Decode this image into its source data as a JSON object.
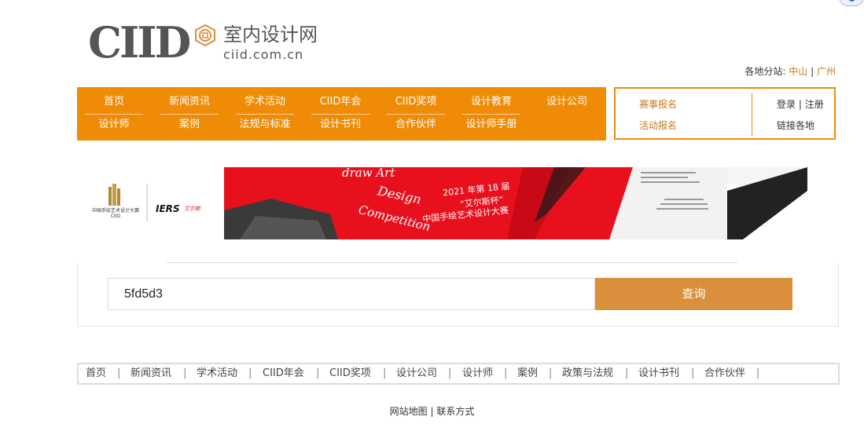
{
  "logo": {
    "mark": "CIID",
    "name_cn": "室内设计网",
    "domain": "ciid.com.cn"
  },
  "branches": {
    "label": "各地分站:",
    "items": [
      "中山",
      "广州"
    ],
    "separator": "|"
  },
  "nav": {
    "row1": [
      "首页",
      "新闻资讯",
      "学术活动",
      "CIID年会",
      "CIID奖项",
      "设计教育",
      "设计公司"
    ],
    "row2": [
      "设计师",
      "案例",
      "法规与标准",
      "设计书刊",
      "合作伙伴",
      "设计师手册"
    ]
  },
  "side": {
    "contest_signup": "赛事报名",
    "event_signup": "活动报名",
    "login": "登录",
    "register": "注册",
    "branch_links": "链接各地"
  },
  "banner": {
    "sponsor1": "中国手绘艺术设计大赛",
    "sponsor1_sub": "CIID",
    "sponsor2": "IERS",
    "sponsor2_sub": "艾尔斯",
    "line1": "draw Art",
    "line2": "Design",
    "line3": "Competition",
    "title1": "2021 年第 18 届",
    "title2": "“艾尔斯杯”",
    "title3": "中国手绘艺术设计大赛"
  },
  "search": {
    "value": "5fd5d3",
    "button": "查询"
  },
  "footer_nav": [
    "首页",
    "新闻资讯",
    "学术活动",
    "CIID年会",
    "CIID奖项",
    "设计公司",
    "设计师",
    "案例",
    "政策与法规",
    "设计书刊",
    "合作伙伴"
  ],
  "footer_bottom": {
    "sitemap": "网站地图",
    "contact": "联系方式"
  },
  "colors": {
    "nav_orange": "#f08b08",
    "search_button": "#d98f3b",
    "banner_red": "#e8101d"
  }
}
